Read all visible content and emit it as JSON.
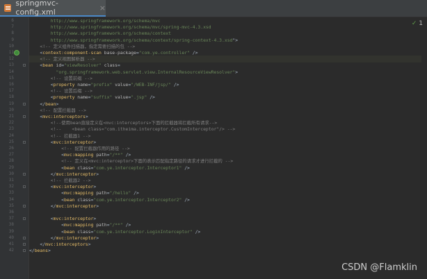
{
  "tab": {
    "title": "springmvc-config.xml",
    "close": "×"
  },
  "inspection": {
    "mark": "✓",
    "count": "1"
  },
  "watermark": "CSDN @Flamklin",
  "lines": [
    {
      "num": "6",
      "tokens": [
        {
          "t": "url",
          "v": "        http://www.springframework.org/schema/mvc"
        }
      ]
    },
    {
      "num": "7",
      "tokens": [
        {
          "t": "url",
          "v": "        http://www.springframework.org/schema/mvc/spring-mvc-4.3.xsd"
        }
      ]
    },
    {
      "num": "8",
      "tokens": [
        {
          "t": "url",
          "v": "        http://www.springframework.org/schema/context"
        }
      ]
    },
    {
      "num": "9",
      "tokens": [
        {
          "t": "url",
          "v": "        http://www.springframework.org/schema/context/spring-context-4.3.xsd"
        },
        {
          "t": "text",
          "v": "\">"
        }
      ]
    },
    {
      "num": "10",
      "tokens": [
        {
          "t": "comment",
          "v": "    <!-- 定义组件扫描器，指定需要扫描的包 -->"
        }
      ]
    },
    {
      "num": "11",
      "tokens": [
        {
          "t": "text",
          "v": "    <"
        },
        {
          "t": "tag",
          "v": "context:component-scan"
        },
        {
          "t": "attr",
          "v": " base-package"
        },
        {
          "t": "text",
          "v": "="
        },
        {
          "t": "val",
          "v": "\"com.ye.controller\""
        },
        {
          "t": "text",
          "v": " />"
        }
      ]
    },
    {
      "num": "12",
      "tokens": [
        {
          "t": "comment",
          "v": "    <!-- 定义视图解析器 -->"
        }
      ]
    },
    {
      "num": "13",
      "tokens": [
        {
          "t": "text",
          "v": "    <"
        },
        {
          "t": "tag",
          "v": "bean"
        },
        {
          "t": "attr",
          "v": " id"
        },
        {
          "t": "text",
          "v": "="
        },
        {
          "t": "val",
          "v": "\"viewResolver\""
        },
        {
          "t": "attr",
          "v": " class"
        },
        {
          "t": "text",
          "v": "="
        }
      ]
    },
    {
      "num": "14",
      "tokens": [
        {
          "t": "val",
          "v": "          \"org.springframework.web.servlet.view.InternalResourceViewResolver\""
        },
        {
          "t": "text",
          "v": ">"
        }
      ]
    },
    {
      "num": "15",
      "tokens": [
        {
          "t": "comment",
          "v": "        <!-- 设置前缀 -->"
        }
      ]
    },
    {
      "num": "16",
      "tokens": [
        {
          "t": "text",
          "v": "        <"
        },
        {
          "t": "tag",
          "v": "property"
        },
        {
          "t": "attr",
          "v": " name"
        },
        {
          "t": "text",
          "v": "="
        },
        {
          "t": "val",
          "v": "\"prefix\""
        },
        {
          "t": "attr",
          "v": " value"
        },
        {
          "t": "text",
          "v": "="
        },
        {
          "t": "val",
          "v": "\"/WEB-INF/jsp/\""
        },
        {
          "t": "text",
          "v": " />"
        }
      ]
    },
    {
      "num": "17",
      "tokens": [
        {
          "t": "comment",
          "v": "        <!-- 设置后缀 -->"
        }
      ]
    },
    {
      "num": "18",
      "tokens": [
        {
          "t": "text",
          "v": "        <"
        },
        {
          "t": "tag",
          "v": "property"
        },
        {
          "t": "attr",
          "v": " name"
        },
        {
          "t": "text",
          "v": "="
        },
        {
          "t": "val",
          "v": "\"suffix\""
        },
        {
          "t": "attr",
          "v": " value"
        },
        {
          "t": "text",
          "v": "="
        },
        {
          "t": "val",
          "v": "\".jsp\""
        },
        {
          "t": "text",
          "v": " />"
        }
      ]
    },
    {
      "num": "19",
      "tokens": [
        {
          "t": "text",
          "v": "    </"
        },
        {
          "t": "tag",
          "v": "bean"
        },
        {
          "t": "text",
          "v": ">"
        }
      ]
    },
    {
      "num": "20",
      "tokens": [
        {
          "t": "comment",
          "v": "    <!-- 配置拦截器 -->"
        }
      ]
    },
    {
      "num": "21",
      "tokens": [
        {
          "t": "text",
          "v": "    <"
        },
        {
          "t": "tag",
          "v": "mvc:interceptors"
        },
        {
          "t": "text",
          "v": ">"
        }
      ]
    },
    {
      "num": "22",
      "tokens": [
        {
          "t": "comment",
          "v": "        <!--使用bean直接定义在<mvc:interceptors>下面的拦截器将拦截所有请求-->"
        }
      ]
    },
    {
      "num": "23",
      "tokens": [
        {
          "t": "comment",
          "v": "        <!--    <bean class=\"com.itheima.interceptor.CustomInterceptor\"/> -->"
        }
      ]
    },
    {
      "num": "24",
      "tokens": [
        {
          "t": "comment",
          "v": "        <!-- 拦截器1 -->"
        }
      ]
    },
    {
      "num": "25",
      "tokens": [
        {
          "t": "text",
          "v": "        <"
        },
        {
          "t": "tag",
          "v": "mvc:interceptor"
        },
        {
          "t": "text",
          "v": ">"
        }
      ]
    },
    {
      "num": "26",
      "tokens": [
        {
          "t": "comment",
          "v": "            <!-- 配置拦截器作用的路径 -->"
        }
      ]
    },
    {
      "num": "27",
      "tokens": [
        {
          "t": "text",
          "v": "            <"
        },
        {
          "t": "tag",
          "v": "mvc:mapping"
        },
        {
          "t": "attr",
          "v": " path"
        },
        {
          "t": "text",
          "v": "="
        },
        {
          "t": "val",
          "v": "\"/**\""
        },
        {
          "t": "text",
          "v": " />"
        }
      ]
    },
    {
      "num": "28",
      "tokens": [
        {
          "t": "comment",
          "v": "            <!-- 定义在<mvc:interceptor>下面的表示匹配指定路径的请求才进行拦截的 -->"
        }
      ]
    },
    {
      "num": "29",
      "tokens": [
        {
          "t": "text",
          "v": "            <"
        },
        {
          "t": "tag",
          "v": "bean"
        },
        {
          "t": "attr",
          "v": " class"
        },
        {
          "t": "text",
          "v": "="
        },
        {
          "t": "val",
          "v": "\"com.ye.interceptor.Interceptor1\""
        },
        {
          "t": "text",
          "v": " />"
        }
      ]
    },
    {
      "num": "30",
      "tokens": [
        {
          "t": "text",
          "v": "        </"
        },
        {
          "t": "tag",
          "v": "mvc:interceptor"
        },
        {
          "t": "text",
          "v": ">"
        }
      ]
    },
    {
      "num": "31",
      "tokens": [
        {
          "t": "comment",
          "v": "        <!-- 拦截器2 -->"
        }
      ]
    },
    {
      "num": "32",
      "tokens": [
        {
          "t": "text",
          "v": "        <"
        },
        {
          "t": "tag",
          "v": "mvc:interceptor"
        },
        {
          "t": "text",
          "v": ">"
        }
      ]
    },
    {
      "num": "33",
      "tokens": [
        {
          "t": "text",
          "v": "            <"
        },
        {
          "t": "tag",
          "v": "mvc:mapping"
        },
        {
          "t": "attr",
          "v": " path"
        },
        {
          "t": "text",
          "v": "="
        },
        {
          "t": "val",
          "v": "\"/hello\""
        },
        {
          "t": "text",
          "v": " />"
        }
      ]
    },
    {
      "num": "34",
      "tokens": [
        {
          "t": "text",
          "v": "            <"
        },
        {
          "t": "tag",
          "v": "bean"
        },
        {
          "t": "attr",
          "v": " class"
        },
        {
          "t": "text",
          "v": "="
        },
        {
          "t": "val",
          "v": "\"com.ye.interceptor.Interceptor2\""
        },
        {
          "t": "text",
          "v": " />"
        }
      ]
    },
    {
      "num": "35",
      "tokens": [
        {
          "t": "text",
          "v": "        </"
        },
        {
          "t": "tag",
          "v": "mvc:interceptor"
        },
        {
          "t": "text",
          "v": ">"
        }
      ]
    },
    {
      "num": "36",
      "tokens": []
    },
    {
      "num": "37",
      "tokens": [
        {
          "t": "text",
          "v": "        <"
        },
        {
          "t": "tag",
          "v": "mvc:interceptor"
        },
        {
          "t": "text",
          "v": ">"
        }
      ]
    },
    {
      "num": "38",
      "tokens": [
        {
          "t": "text",
          "v": "            <"
        },
        {
          "t": "tag",
          "v": "mvc:mapping"
        },
        {
          "t": "attr",
          "v": " path"
        },
        {
          "t": "text",
          "v": "="
        },
        {
          "t": "val",
          "v": "\"/**\""
        },
        {
          "t": "text",
          "v": " />"
        }
      ]
    },
    {
      "num": "39",
      "tokens": [
        {
          "t": "text",
          "v": "            <"
        },
        {
          "t": "tag",
          "v": "bean"
        },
        {
          "t": "attr",
          "v": " class"
        },
        {
          "t": "text",
          "v": "="
        },
        {
          "t": "val",
          "v": "\"com.ye.interceptor.LoginInterceptor\""
        },
        {
          "t": "text",
          "v": " />"
        }
      ]
    },
    {
      "num": "40",
      "tokens": [
        {
          "t": "text",
          "v": "        </"
        },
        {
          "t": "tag",
          "v": "mvc:interceptor"
        },
        {
          "t": "text",
          "v": ">"
        }
      ]
    },
    {
      "num": "41",
      "tokens": [
        {
          "t": "text",
          "v": "    </"
        },
        {
          "t": "tag",
          "v": "mvc:interceptors"
        },
        {
          "t": "text",
          "v": ">"
        }
      ]
    },
    {
      "num": "42",
      "tokens": [
        {
          "t": "text",
          "v": "</"
        },
        {
          "t": "tag",
          "v": "beans"
        },
        {
          "t": "text",
          "v": ">"
        }
      ]
    }
  ],
  "current_line": "12",
  "gutter_icon_line": "11",
  "fold_lines": [
    "13",
    "19",
    "21",
    "25",
    "30",
    "32",
    "35",
    "37",
    "40",
    "41",
    "42"
  ]
}
